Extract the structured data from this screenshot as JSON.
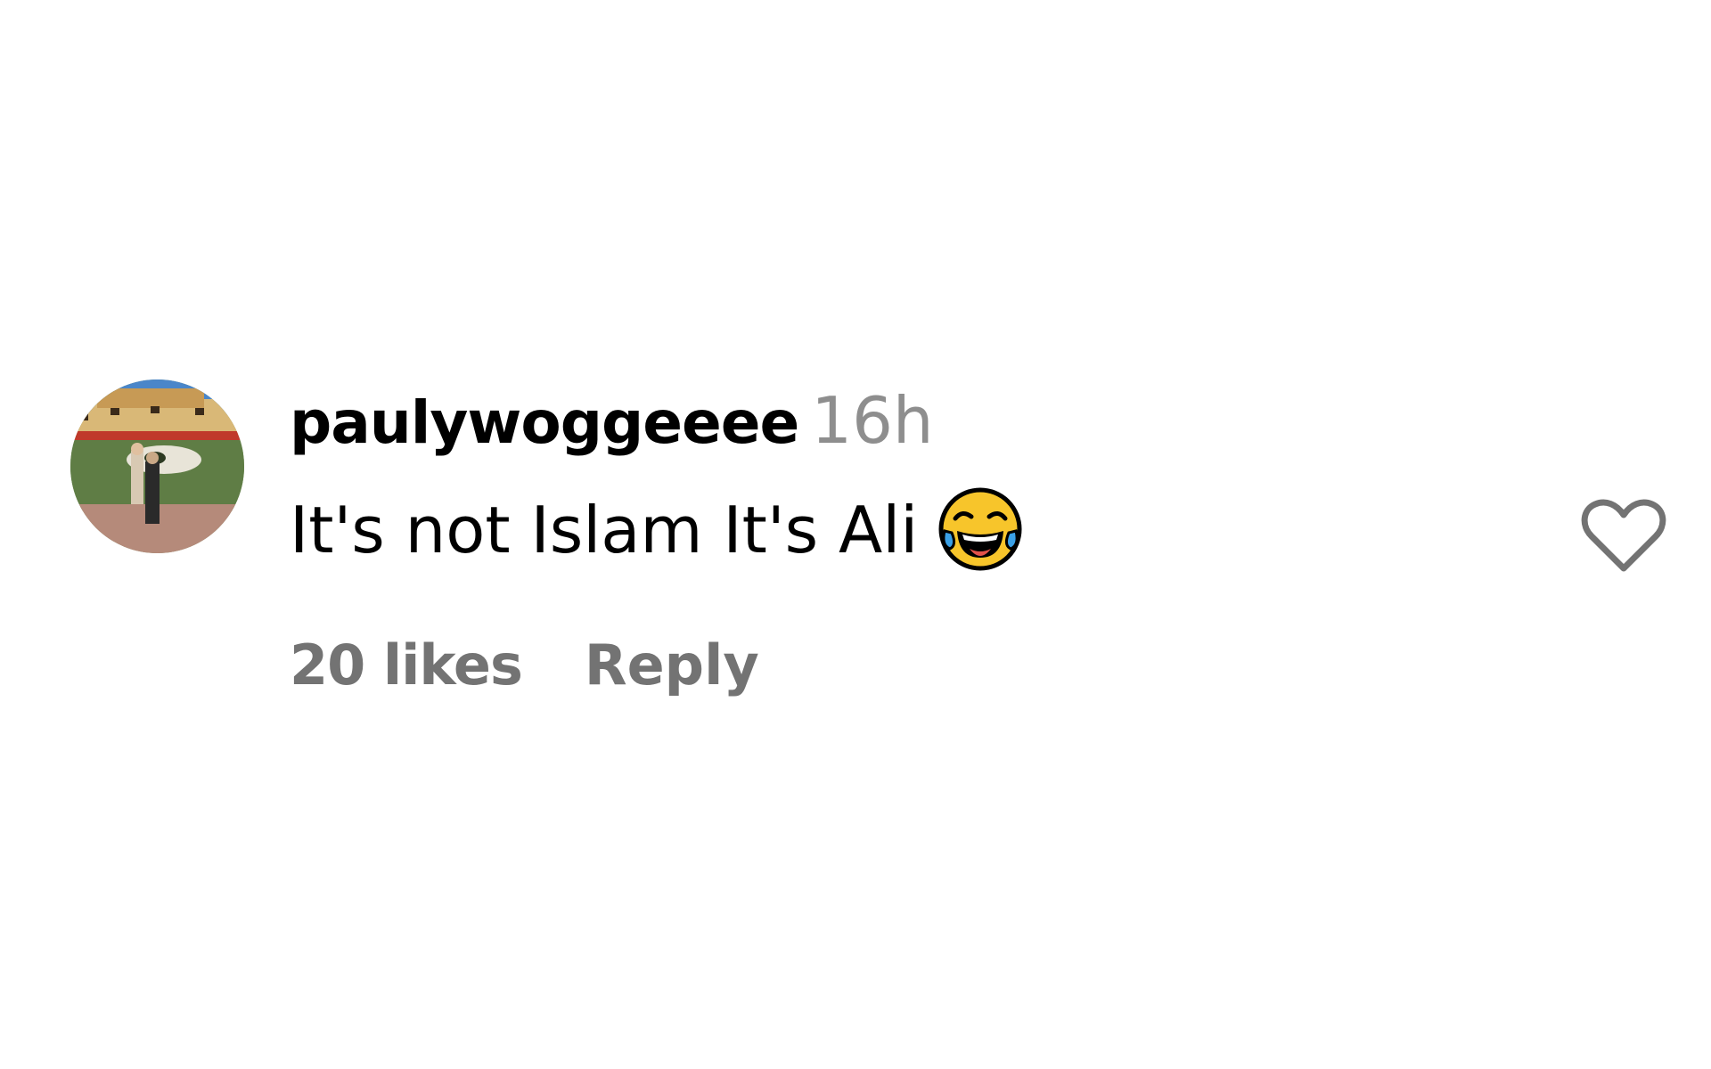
{
  "comment": {
    "username": "paulywoggeeee",
    "timestamp": "16h",
    "text": "It's not Islam It's Ali",
    "emoji": "face-with-tears-of-joy",
    "likes_label": "20 likes",
    "reply_label": "Reply"
  },
  "icons": {
    "like": "heart-outline-icon",
    "avatar": "profile-photo"
  },
  "colors": {
    "primary_text": "#000000",
    "secondary_text": "#737373",
    "timestamp_text": "#8e8e8e",
    "background": "#ffffff"
  }
}
